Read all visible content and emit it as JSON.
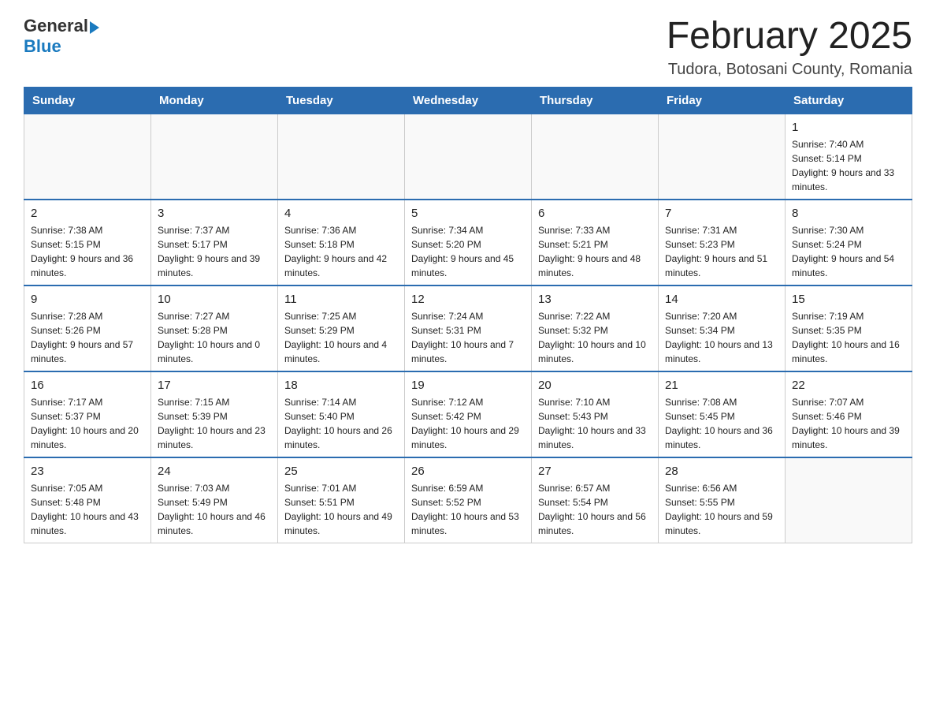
{
  "header": {
    "logo_general": "General",
    "logo_blue": "Blue",
    "month_title": "February 2025",
    "location": "Tudora, Botosani County, Romania"
  },
  "days_of_week": [
    "Sunday",
    "Monday",
    "Tuesday",
    "Wednesday",
    "Thursday",
    "Friday",
    "Saturday"
  ],
  "weeks": [
    [
      {
        "day": "",
        "info": ""
      },
      {
        "day": "",
        "info": ""
      },
      {
        "day": "",
        "info": ""
      },
      {
        "day": "",
        "info": ""
      },
      {
        "day": "",
        "info": ""
      },
      {
        "day": "",
        "info": ""
      },
      {
        "day": "1",
        "info": "Sunrise: 7:40 AM\nSunset: 5:14 PM\nDaylight: 9 hours and 33 minutes."
      }
    ],
    [
      {
        "day": "2",
        "info": "Sunrise: 7:38 AM\nSunset: 5:15 PM\nDaylight: 9 hours and 36 minutes."
      },
      {
        "day": "3",
        "info": "Sunrise: 7:37 AM\nSunset: 5:17 PM\nDaylight: 9 hours and 39 minutes."
      },
      {
        "day": "4",
        "info": "Sunrise: 7:36 AM\nSunset: 5:18 PM\nDaylight: 9 hours and 42 minutes."
      },
      {
        "day": "5",
        "info": "Sunrise: 7:34 AM\nSunset: 5:20 PM\nDaylight: 9 hours and 45 minutes."
      },
      {
        "day": "6",
        "info": "Sunrise: 7:33 AM\nSunset: 5:21 PM\nDaylight: 9 hours and 48 minutes."
      },
      {
        "day": "7",
        "info": "Sunrise: 7:31 AM\nSunset: 5:23 PM\nDaylight: 9 hours and 51 minutes."
      },
      {
        "day": "8",
        "info": "Sunrise: 7:30 AM\nSunset: 5:24 PM\nDaylight: 9 hours and 54 minutes."
      }
    ],
    [
      {
        "day": "9",
        "info": "Sunrise: 7:28 AM\nSunset: 5:26 PM\nDaylight: 9 hours and 57 minutes."
      },
      {
        "day": "10",
        "info": "Sunrise: 7:27 AM\nSunset: 5:28 PM\nDaylight: 10 hours and 0 minutes."
      },
      {
        "day": "11",
        "info": "Sunrise: 7:25 AM\nSunset: 5:29 PM\nDaylight: 10 hours and 4 minutes."
      },
      {
        "day": "12",
        "info": "Sunrise: 7:24 AM\nSunset: 5:31 PM\nDaylight: 10 hours and 7 minutes."
      },
      {
        "day": "13",
        "info": "Sunrise: 7:22 AM\nSunset: 5:32 PM\nDaylight: 10 hours and 10 minutes."
      },
      {
        "day": "14",
        "info": "Sunrise: 7:20 AM\nSunset: 5:34 PM\nDaylight: 10 hours and 13 minutes."
      },
      {
        "day": "15",
        "info": "Sunrise: 7:19 AM\nSunset: 5:35 PM\nDaylight: 10 hours and 16 minutes."
      }
    ],
    [
      {
        "day": "16",
        "info": "Sunrise: 7:17 AM\nSunset: 5:37 PM\nDaylight: 10 hours and 20 minutes."
      },
      {
        "day": "17",
        "info": "Sunrise: 7:15 AM\nSunset: 5:39 PM\nDaylight: 10 hours and 23 minutes."
      },
      {
        "day": "18",
        "info": "Sunrise: 7:14 AM\nSunset: 5:40 PM\nDaylight: 10 hours and 26 minutes."
      },
      {
        "day": "19",
        "info": "Sunrise: 7:12 AM\nSunset: 5:42 PM\nDaylight: 10 hours and 29 minutes."
      },
      {
        "day": "20",
        "info": "Sunrise: 7:10 AM\nSunset: 5:43 PM\nDaylight: 10 hours and 33 minutes."
      },
      {
        "day": "21",
        "info": "Sunrise: 7:08 AM\nSunset: 5:45 PM\nDaylight: 10 hours and 36 minutes."
      },
      {
        "day": "22",
        "info": "Sunrise: 7:07 AM\nSunset: 5:46 PM\nDaylight: 10 hours and 39 minutes."
      }
    ],
    [
      {
        "day": "23",
        "info": "Sunrise: 7:05 AM\nSunset: 5:48 PM\nDaylight: 10 hours and 43 minutes."
      },
      {
        "day": "24",
        "info": "Sunrise: 7:03 AM\nSunset: 5:49 PM\nDaylight: 10 hours and 46 minutes."
      },
      {
        "day": "25",
        "info": "Sunrise: 7:01 AM\nSunset: 5:51 PM\nDaylight: 10 hours and 49 minutes."
      },
      {
        "day": "26",
        "info": "Sunrise: 6:59 AM\nSunset: 5:52 PM\nDaylight: 10 hours and 53 minutes."
      },
      {
        "day": "27",
        "info": "Sunrise: 6:57 AM\nSunset: 5:54 PM\nDaylight: 10 hours and 56 minutes."
      },
      {
        "day": "28",
        "info": "Sunrise: 6:56 AM\nSunset: 5:55 PM\nDaylight: 10 hours and 59 minutes."
      },
      {
        "day": "",
        "info": ""
      }
    ]
  ]
}
